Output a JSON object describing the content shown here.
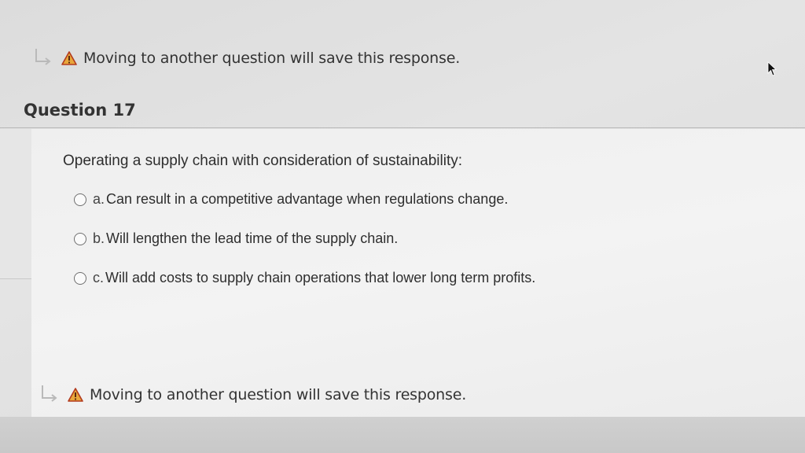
{
  "notice": {
    "text": "Moving to another question will save this response."
  },
  "question": {
    "title": "Question 17",
    "prompt": "Operating a supply chain with consideration of sustainability:",
    "options": [
      {
        "letter": "a.",
        "text": "Can result in a competitive advantage when regulations change."
      },
      {
        "letter": "b.",
        "text": "Will lengthen the lead time of the supply chain."
      },
      {
        "letter": "c.",
        "text": "Will add costs to supply chain operations that lower long term profits."
      }
    ]
  },
  "icons": {
    "return": "return-arrow-icon",
    "warning": "warning-icon",
    "cursor": "mouse-cursor-icon"
  },
  "colors": {
    "warning_fill": "#e8a63a",
    "warning_stroke": "#b23a1e",
    "arrow": "#b9b9b9"
  }
}
